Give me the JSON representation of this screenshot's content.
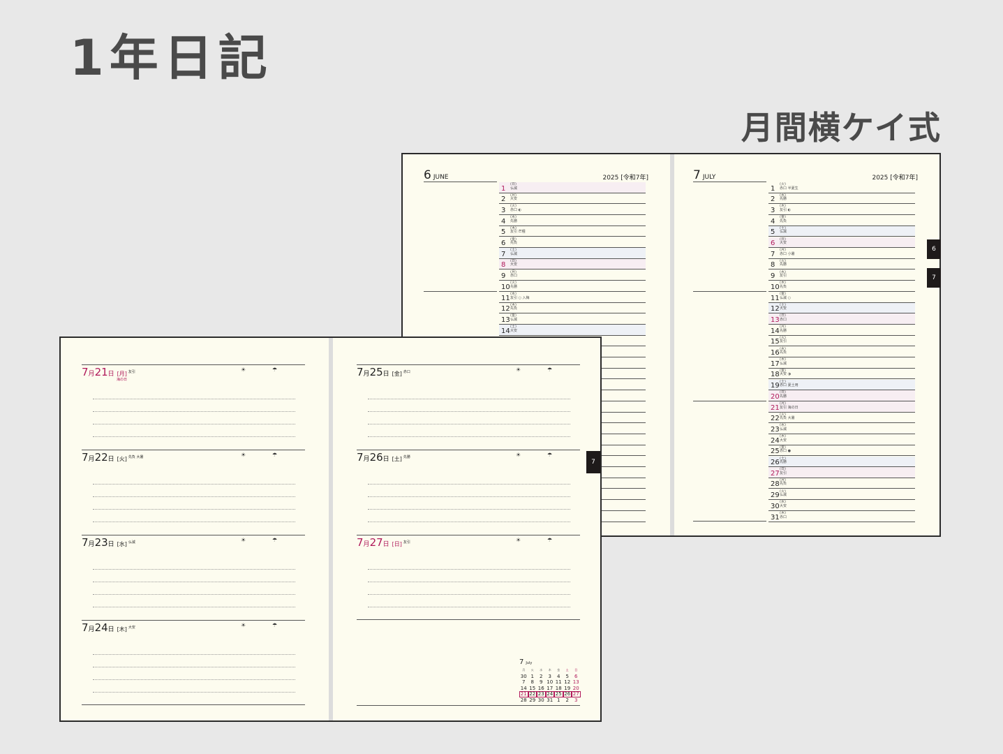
{
  "header": {
    "title": "1年日記",
    "subtitle": "月間横ケイ式"
  },
  "monthly_spread": {
    "left": {
      "month_num": "6",
      "month_name": "JUNE",
      "year_label": "2025 [令和7年]",
      "days": [
        {
          "d": "1",
          "wd": "(日)",
          "rk": "仏滅",
          "type": "sun"
        },
        {
          "d": "2",
          "wd": "(月)",
          "rk": "大安",
          "type": ""
        },
        {
          "d": "3",
          "wd": "(火)",
          "rk": "赤口 ◐",
          "type": ""
        },
        {
          "d": "4",
          "wd": "(水)",
          "rk": "先勝",
          "type": ""
        },
        {
          "d": "5",
          "wd": "(木)",
          "rk": "友引 芒種",
          "type": ""
        },
        {
          "d": "6",
          "wd": "(金)",
          "rk": "先負",
          "type": ""
        },
        {
          "d": "7",
          "wd": "(土)",
          "rk": "仏滅",
          "type": "sat"
        },
        {
          "d": "8",
          "wd": "(日)",
          "rk": "大安",
          "type": "sun"
        },
        {
          "d": "9",
          "wd": "(月)",
          "rk": "赤口",
          "type": ""
        },
        {
          "d": "10",
          "wd": "(火)",
          "rk": "先勝",
          "type": ""
        },
        {
          "d": "11",
          "wd": "(水)",
          "rk": "友引 ○ 入梅",
          "type": ""
        },
        {
          "d": "12",
          "wd": "(木)",
          "rk": "先負",
          "type": ""
        },
        {
          "d": "13",
          "wd": "(金)",
          "rk": "仏滅",
          "type": ""
        },
        {
          "d": "14",
          "wd": "(土)",
          "rk": "大安",
          "type": "sat"
        }
      ]
    },
    "right": {
      "month_num": "7",
      "month_name": "JULY",
      "year_label": "2025 [令和7年]",
      "days": [
        {
          "d": "1",
          "wd": "(火)",
          "rk": "赤口 半夏生",
          "type": ""
        },
        {
          "d": "2",
          "wd": "(水)",
          "rk": "先勝",
          "type": ""
        },
        {
          "d": "3",
          "wd": "(木)",
          "rk": "友引 ◐",
          "type": ""
        },
        {
          "d": "4",
          "wd": "(金)",
          "rk": "先負",
          "type": ""
        },
        {
          "d": "5",
          "wd": "(土)",
          "rk": "仏滅",
          "type": "sat"
        },
        {
          "d": "6",
          "wd": "(日)",
          "rk": "大安",
          "type": "sun"
        },
        {
          "d": "7",
          "wd": "(月)",
          "rk": "赤口 小暑",
          "type": ""
        },
        {
          "d": "8",
          "wd": "(火)",
          "rk": "先勝",
          "type": ""
        },
        {
          "d": "9",
          "wd": "(水)",
          "rk": "友引",
          "type": ""
        },
        {
          "d": "10",
          "wd": "(木)",
          "rk": "先負",
          "type": ""
        },
        {
          "d": "11",
          "wd": "(金)",
          "rk": "仏滅 ○",
          "type": ""
        },
        {
          "d": "12",
          "wd": "(土)",
          "rk": "大安",
          "type": "sat"
        },
        {
          "d": "13",
          "wd": "(日)",
          "rk": "赤口",
          "type": "sun"
        },
        {
          "d": "14",
          "wd": "(月)",
          "rk": "先勝",
          "type": ""
        },
        {
          "d": "15",
          "wd": "(火)",
          "rk": "友引",
          "type": ""
        },
        {
          "d": "16",
          "wd": "(水)",
          "rk": "先負",
          "type": ""
        },
        {
          "d": "17",
          "wd": "(木)",
          "rk": "仏滅",
          "type": ""
        },
        {
          "d": "18",
          "wd": "(金)",
          "rk": "大安 ◑",
          "type": ""
        },
        {
          "d": "19",
          "wd": "(土)",
          "rk": "赤口 夏土用",
          "type": "sat"
        },
        {
          "d": "20",
          "wd": "(日)",
          "rk": "先勝",
          "type": "sun"
        },
        {
          "d": "21",
          "wd": "(月)",
          "rk": "友引 海の日",
          "type": "hol"
        },
        {
          "d": "22",
          "wd": "(火)",
          "rk": "先負 大暑",
          "type": ""
        },
        {
          "d": "23",
          "wd": "(水)",
          "rk": "仏滅",
          "type": ""
        },
        {
          "d": "24",
          "wd": "(木)",
          "rk": "大安",
          "type": ""
        },
        {
          "d": "25",
          "wd": "(金)",
          "rk": "赤口 ●",
          "type": ""
        },
        {
          "d": "26",
          "wd": "(土)",
          "rk": "先勝",
          "type": "sat"
        },
        {
          "d": "27",
          "wd": "(日)",
          "rk": "友引",
          "type": "sun"
        },
        {
          "d": "28",
          "wd": "(月)",
          "rk": "先負",
          "type": ""
        },
        {
          "d": "29",
          "wd": "(火)",
          "rk": "仏滅",
          "type": ""
        },
        {
          "d": "30",
          "wd": "(水)",
          "rk": "大安",
          "type": ""
        },
        {
          "d": "31",
          "wd": "(木)",
          "rk": "赤口",
          "type": ""
        }
      ]
    },
    "tabs": [
      "6",
      "7"
    ]
  },
  "daily_spread": {
    "tab": "7",
    "weather_icons": [
      "☀︎",
      "☂"
    ],
    "left_entries": [
      {
        "m": "7",
        "m_unit": "月",
        "d": "21",
        "d_unit": "日",
        "wd": "[月]",
        "rk": "友引",
        "holiday": "海の日",
        "red": true
      },
      {
        "m": "7",
        "m_unit": "月",
        "d": "22",
        "d_unit": "日",
        "wd": "[火]",
        "rk": "先負 大暑",
        "holiday": "",
        "red": false
      },
      {
        "m": "7",
        "m_unit": "月",
        "d": "23",
        "d_unit": "日",
        "wd": "[水]",
        "rk": "仏滅",
        "holiday": "",
        "red": false
      },
      {
        "m": "7",
        "m_unit": "月",
        "d": "24",
        "d_unit": "日",
        "wd": "[木]",
        "rk": "大安",
        "holiday": "",
        "red": false
      }
    ],
    "right_entries": [
      {
        "m": "7",
        "m_unit": "月",
        "d": "25",
        "d_unit": "日",
        "wd": "[金]",
        "rk": "赤口",
        "holiday": "",
        "red": false
      },
      {
        "m": "7",
        "m_unit": "月",
        "d": "26",
        "d_unit": "日",
        "wd": "[土]",
        "rk": "先勝",
        "holiday": "",
        "red": false
      },
      {
        "m": "7",
        "m_unit": "月",
        "d": "27",
        "d_unit": "日",
        "wd": "[日]",
        "rk": "友引",
        "holiday": "",
        "red": true
      }
    ],
    "mini_calendar": {
      "month": "7",
      "name": "July",
      "weekdays": [
        "月",
        "火",
        "水",
        "木",
        "金",
        "土",
        "日"
      ],
      "weeks": [
        [
          "30",
          "1",
          "2",
          "3",
          "4",
          "5",
          "6"
        ],
        [
          "7",
          "8",
          "9",
          "10",
          "11",
          "12",
          "13"
        ],
        [
          "14",
          "15",
          "16",
          "17",
          "18",
          "19",
          "20"
        ],
        [
          "21",
          "22",
          "23",
          "24",
          "25",
          "26",
          "27"
        ],
        [
          "28",
          "29",
          "30",
          "31",
          "1",
          "2",
          "3"
        ]
      ]
    }
  }
}
